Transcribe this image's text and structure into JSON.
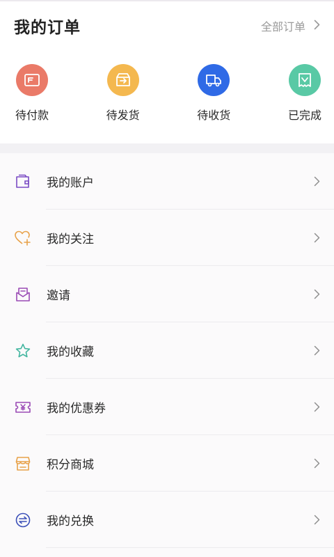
{
  "orders": {
    "title": "我的订单",
    "all_orders_label": "全部订单",
    "statuses": [
      {
        "label": "待付款",
        "icon": "wallet-card-icon",
        "color": "#ea7a68"
      },
      {
        "label": "待发货",
        "icon": "box-ship-icon",
        "color": "#f4b84f"
      },
      {
        "label": "待收货",
        "icon": "truck-icon",
        "color": "#2f6ae6"
      },
      {
        "label": "已完成",
        "icon": "receipt-check-icon",
        "color": "#59c9a5"
      }
    ]
  },
  "menu": {
    "items": [
      {
        "label": "我的账户",
        "icon": "wallet-icon",
        "color": "#7a4bc4"
      },
      {
        "label": "我的关注",
        "icon": "heart-plus-icon",
        "color": "#e8a24a"
      },
      {
        "label": "邀请",
        "icon": "envelope-icon",
        "color": "#9a4ab5"
      },
      {
        "label": "我的收藏",
        "icon": "star-icon",
        "color": "#43b6a0"
      },
      {
        "label": "我的优惠券",
        "icon": "coupon-yen-icon",
        "color": "#9a4ab5"
      },
      {
        "label": "积分商城",
        "icon": "store-icon",
        "color": "#e8a24a"
      },
      {
        "label": "我的兑换",
        "icon": "exchange-icon",
        "color": "#3b4fb8"
      }
    ]
  }
}
